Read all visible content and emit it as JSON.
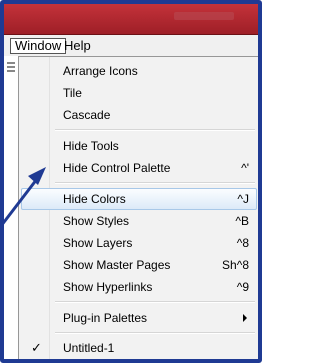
{
  "menubar": {
    "items": [
      "Window",
      "Help"
    ]
  },
  "menu": {
    "items": [
      {
        "label": "Arrange Icons",
        "shortcut": ""
      },
      {
        "label": "Tile",
        "shortcut": ""
      },
      {
        "label": "Cascade",
        "shortcut": ""
      },
      {
        "label": "Hide Tools",
        "shortcut": ""
      },
      {
        "label": "Hide Control Palette",
        "shortcut": "^'"
      },
      {
        "label": "Hide Colors",
        "shortcut": "^J"
      },
      {
        "label": "Show Styles",
        "shortcut": "^B"
      },
      {
        "label": "Show Layers",
        "shortcut": "^8"
      },
      {
        "label": "Show Master Pages",
        "shortcut": "Sh^8"
      },
      {
        "label": "Show Hyperlinks",
        "shortcut": "^9"
      },
      {
        "label": "Plug-in Palettes",
        "shortcut": ""
      },
      {
        "label": "Untitled-1",
        "shortcut": ""
      }
    ],
    "highlighted_item": "Hide Colors",
    "checked_item": "Untitled-1"
  },
  "icons": {
    "check": "checkmark-icon",
    "submenu": "submenu-arrow-icon",
    "pointer": "pointer-arrow-icon"
  },
  "colors": {
    "frame_border": "#1f3a93",
    "titlebar": "#b02a32",
    "highlight_fill": "#dceaf8",
    "highlight_border": "#a8c8e8",
    "pointer_arrow": "#1f3a93"
  }
}
